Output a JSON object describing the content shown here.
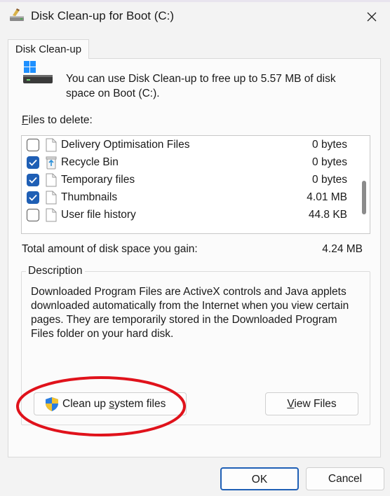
{
  "window": {
    "title": "Disk Clean-up for Boot (C:)"
  },
  "tab": {
    "label": "Disk Clean-up"
  },
  "intro_text": "You can use Disk Clean-up to free up to 5.57 MB of disk space on Boot (C:).",
  "files_label_prefix": "F",
  "files_label_rest": "iles to delete:",
  "files": [
    {
      "name": "Delivery Optimisation Files",
      "size": "0 bytes",
      "checked": false,
      "icon": "file-icon"
    },
    {
      "name": "Recycle Bin",
      "size": "0 bytes",
      "checked": true,
      "icon": "recycle-bin-icon"
    },
    {
      "name": "Temporary files",
      "size": "0 bytes",
      "checked": true,
      "icon": "file-icon"
    },
    {
      "name": "Thumbnails",
      "size": "4.01 MB",
      "checked": true,
      "icon": "file-icon"
    },
    {
      "name": "User file history",
      "size": "44.8 KB",
      "checked": false,
      "icon": "file-icon"
    }
  ],
  "total": {
    "label": "Total amount of disk space you gain:",
    "value": "4.24 MB"
  },
  "description": {
    "legend": "Description",
    "text": "Downloaded Program Files are ActiveX controls and Java applets downloaded automatically from the Internet when you view certain pages. They are temporarily stored in the Downloaded Program Files folder on your hard disk."
  },
  "buttons": {
    "clean_system_pre": "Clean up ",
    "clean_system_ul": "s",
    "clean_system_post": "ystem files",
    "view_ul": "V",
    "view_rest": "iew Files",
    "ok": "OK",
    "cancel": "Cancel"
  },
  "colors": {
    "accent": "#1f5fb5",
    "highlight_ring": "#e0121b"
  }
}
